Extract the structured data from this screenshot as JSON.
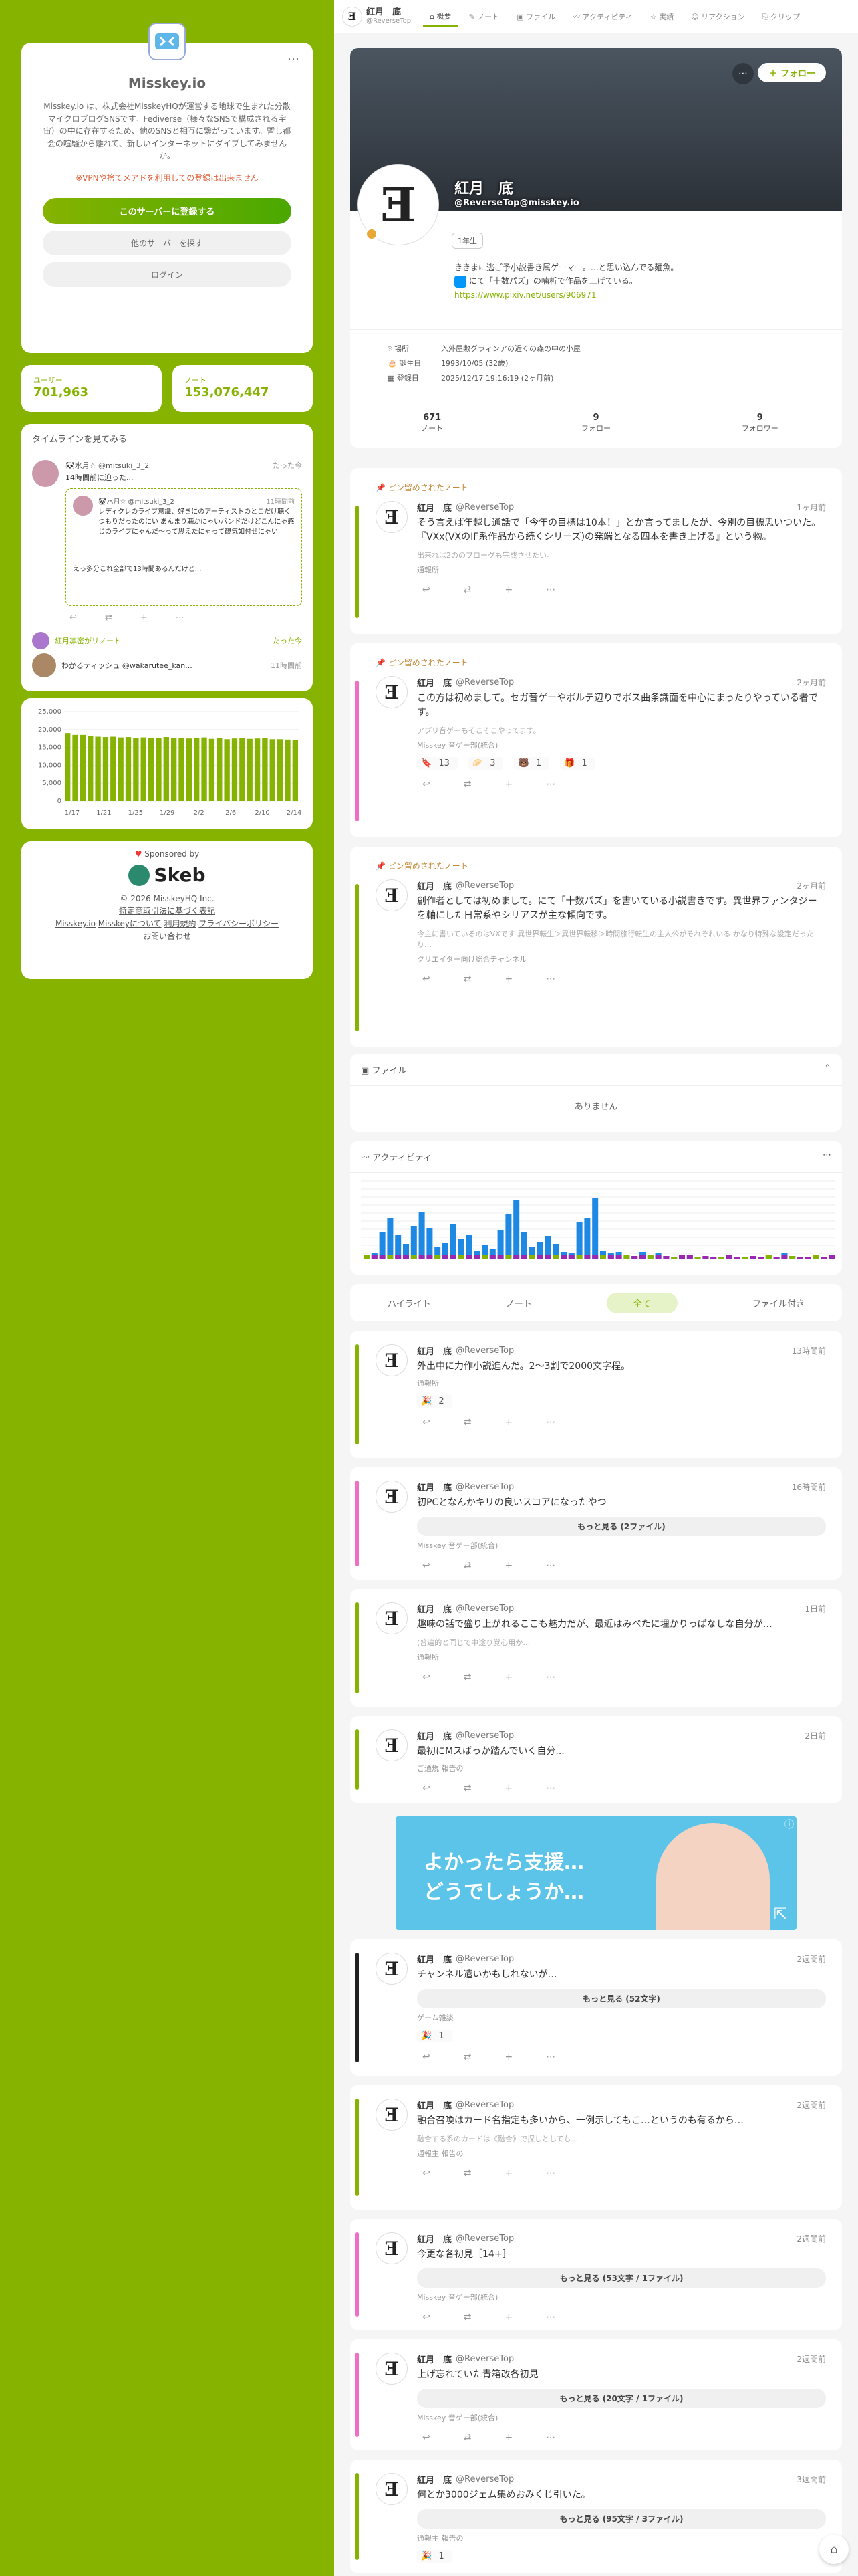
{
  "instance": {
    "name": "Misskey.io",
    "desc": "Misskey.io は、株式会社MisskeyHQが運営する地球で生まれた分散マイクロブログSNSです。Fediverse（様々なSNSで構成される宇宙）の中に存在するため、他のSNSと相互に繋がっています。暫し都会の喧騒から離れて、新しいインターネットにダイブしてみませんか。",
    "warn": "※VPNや捨てメアドを利用しての登録は出来ません",
    "signup": "このサーバーに登録する",
    "explore": "他のサーバーを探す",
    "login": "ログイン",
    "dots": "⋯"
  },
  "stats": {
    "users_label": "ユーザー",
    "users": "701,963",
    "notes_label": "ノート",
    "notes": "153,076,447"
  },
  "timeline": {
    "title": "タイムラインを見てみる",
    "item1_name": "🐼水月☆ @mitsuki_3_2",
    "item1_time": "たった今",
    "item1_text": "14時間前に迫った...",
    "quote_name": "🐼水月☆ @mitsuki_3_2",
    "quote_time": "11時間前",
    "quote_text": "レディクレのライブ意識、好きにのアーティストのとこだけ聴くつもりだったのにい あんまり聴かにゃいバンドだけどこんにゃ感じのライブにゃんだ～って思えたにゃって観気如付せにゃい",
    "quote_text2": "えっ多分これ全部で13時間あるんだけど...",
    "renote": "紅月凛密がリノート",
    "renote_time": "たった今",
    "item2_name": "わかるティッシュ @wakarutee_kan...",
    "item2_time": "11時間前"
  },
  "chart_data": {
    "type": "bar",
    "categories": [
      "1/17",
      "1/21",
      "1/25",
      "1/29",
      "2/2",
      "2/6",
      "2/10",
      "2/14"
    ],
    "values": [
      19000,
      18500,
      18500,
      18200,
      18000,
      17900,
      18000,
      17800,
      17900,
      17700,
      17800,
      17600,
      17700,
      17900,
      17600,
      17700,
      17500,
      17600,
      17800,
      17400,
      17600,
      17300,
      17500,
      17700,
      17400,
      17500,
      17600,
      17300,
      17300,
      17200,
      17100
    ],
    "yticks": [
      "25,000",
      "20,000",
      "15,000",
      "10,000",
      "5,000",
      "0"
    ],
    "ylim": [
      0,
      25000
    ]
  },
  "sponsor": {
    "label": "Sponsored by",
    "name": "Skeb",
    "copyright": "© 2026 MisskeyHQ Inc.",
    "law": "特定商取引法に基づく表記",
    "links": [
      "Misskey.io",
      "Misskeyについて",
      "利用規約",
      "プライバシーポリシー",
      "お問い合わせ"
    ]
  },
  "header": {
    "name": "紅月　底",
    "acct": "@ReverseTop",
    "tabs": [
      "概要",
      "ノート",
      "ファイル",
      "アクティビティ",
      "実績",
      "リアクション",
      "クリップ"
    ]
  },
  "profile": {
    "name": "紅月　底",
    "acct": "@ReverseTop@misskey.io",
    "follow": "フォロー",
    "badge": "1年生",
    "bio1": "ききまに逃ご予小説書き属ゲーマー。…と思い込んでる麺魚。",
    "bio2": "にて「十数パズ」の噛析で作品を上げている。",
    "link": "https://www.pixiv.net/users/906971",
    "loc_label": "場所",
    "loc": "入外屋敷グラィンアの近くの森の中の小屋",
    "birth_label": "誕生日",
    "birth": "1993/10/05 (32歳)",
    "reg_label": "登録日",
    "reg": "2025/12/17 19:16:19 (2ヶ月前)",
    "notes": "671",
    "notes_label": "ノート",
    "follow_count": "9",
    "follow_label": "フォロー",
    "followers": "9",
    "followers_label": "フォロワー"
  },
  "pinned": {
    "label": "ピン留めされたノート",
    "n1_time": "1ヶ月前",
    "n1_text": "そう言えば年越し通話で「今年の目標は10本！」とか言ってましたが、今別の目標思いついた。『VXx(VXのIF系作品から続くシリーズ)の発端となる四本を書き上げる』という物。",
    "n1_small": "出来れば2ののブローグも完成させたい。",
    "n1_ch": "通報所",
    "n2_time": "2ヶ月前",
    "n2_text": "この方は初めまして。セガ音ゲーやボルテ辺りでボス曲条識面を中心にまったりやっている者です。",
    "n2_small": "アプリ音ゲーもそこそこやってます。",
    "n2_ch": "Misskey 音ゲー部(統合)",
    "n2_r": [
      "13",
      "3",
      "1",
      "1"
    ],
    "n3_time": "2ヶ月前",
    "n3_text": "創作者としては初めまして。にて「十数パズ」を書いている小説書きです。異世界ファンタジーを軸にした日常系やシリアスが主な傾向です。",
    "n3_small": "今主に書いているのはVXです 異世界転生＞異世界転移＞時間旅行転生の主人公がそれぞれいる かなり特殊な設定だったり…",
    "n3_ch": "クリエイター向け総合チャンネル"
  },
  "files": {
    "title": "ファイル",
    "empty": "ありません"
  },
  "activity": {
    "title": "アクティビティ"
  },
  "feedtabs": [
    "ハイライト",
    "ノート",
    "全て",
    "ファイル付き"
  ],
  "feed": [
    {
      "time": "13時間前",
      "text": "外出中に力作小説進んだ。2～3割で2000文字程。",
      "ch": "通報所",
      "r": "2"
    },
    {
      "time": "16時間前",
      "text": "初PCとなんかキリの良いスコアになったやつ",
      "more": "もっと見る (2ファイル)",
      "ch": "Misskey 音ゲー部(統合)"
    },
    {
      "time": "1日前",
      "text": "趣味の話で盛り上がれるここも魅力だが、最近はみべたに埋かりっぱなしな自分が…",
      "small": "(普遍的と同じで中途り覚心用か…",
      "ch": "通報所"
    },
    {
      "time": "2日前",
      "text": "最初にMスばっか踏んでいく自分...",
      "ch": "ご通規 報告の"
    },
    {
      "time": "2週間前",
      "text": "チャンネル遣いかもしれないが…",
      "more": "もっと見る (52文字)",
      "ch": "ゲーム雑談",
      "r": "1"
    },
    {
      "time": "2週間前",
      "text": "融合召喚はカード名指定も多いから、一例示してもこ…というのも有るから…",
      "small": "融合する系のカードは《融合》で探しとしても…",
      "ch": "通報主 報告の"
    },
    {
      "time": "2週間前",
      "text": "今更な各初見［14+］",
      "more": "もっと見る (53文字 / 1ファイル)",
      "ch": "Misskey 音ゲー部(統合)"
    },
    {
      "time": "2週間前",
      "text": "上げ忘れていた青箱改各初見",
      "more": "もっと見る (20文字 / 1ファイル)",
      "ch": "Misskey 音ゲー部(統合)"
    },
    {
      "time": "3週間前",
      "text": "何とか3000ジェム集めおみくじ引いた。",
      "more": "もっと見る (95文字 / 3ファイル)",
      "ch": "通報主 報告の",
      "r": "1"
    }
  ],
  "ad": {
    "line1": "よかったら支援…",
    "line2": "どうでしょうか…"
  },
  "colors": {
    "accent": "#86b300",
    "pink": "#f06fc4",
    "dark": "#222222"
  }
}
